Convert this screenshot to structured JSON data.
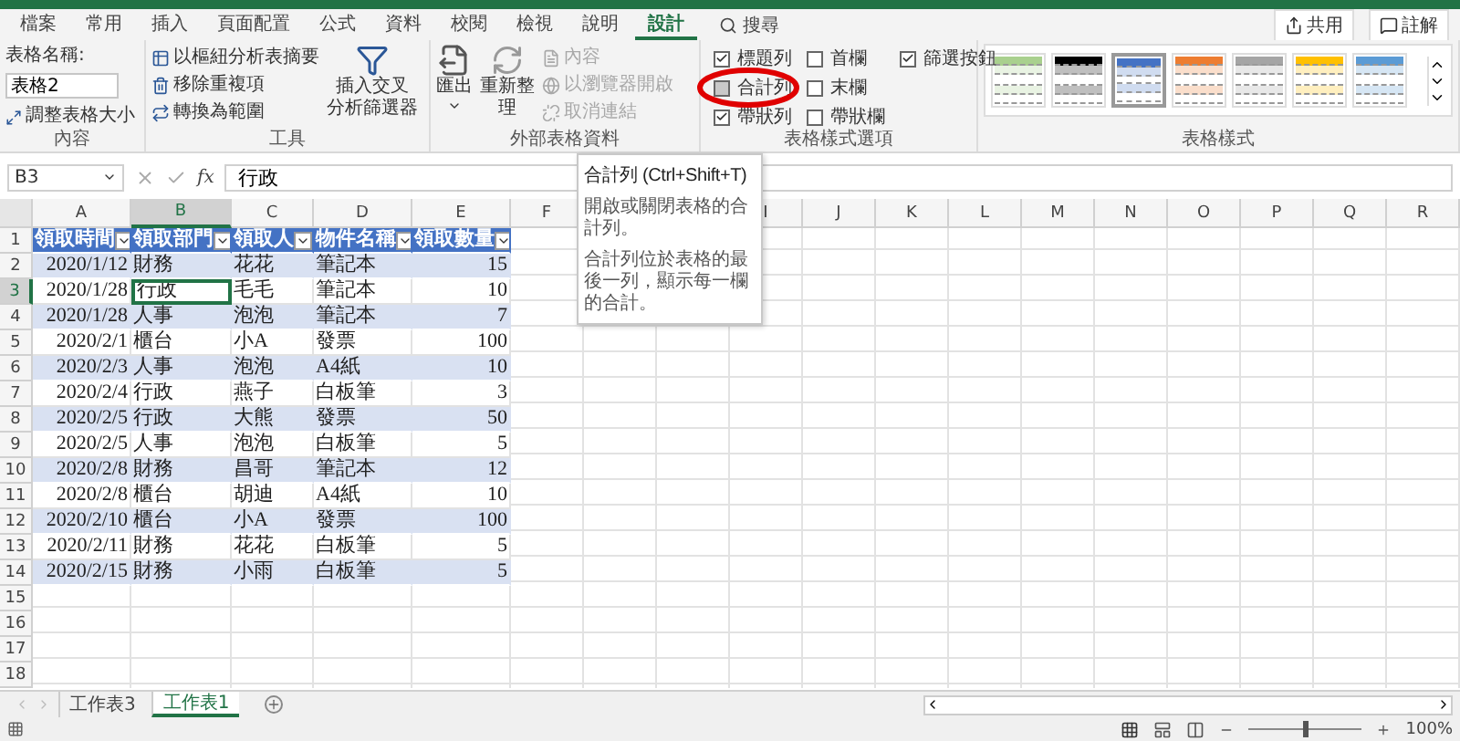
{
  "ribbon_tabs": [
    {
      "label": "檔案",
      "selected": false
    },
    {
      "label": "常用",
      "selected": false
    },
    {
      "label": "插入",
      "selected": false
    },
    {
      "label": "頁面配置",
      "selected": false
    },
    {
      "label": "公式",
      "selected": false
    },
    {
      "label": "資料",
      "selected": false
    },
    {
      "label": "校閱",
      "selected": false
    },
    {
      "label": "檢視",
      "selected": false
    },
    {
      "label": "說明",
      "selected": false
    },
    {
      "label": "設計",
      "selected": true
    }
  ],
  "search": {
    "label": "搜尋"
  },
  "header_buttons": [
    {
      "kind": "share",
      "label": "共用"
    },
    {
      "kind": "comment",
      "label": "註解"
    }
  ],
  "properties": {
    "title": "內容",
    "name_label": "表格名稱:",
    "name_value": "表格2",
    "resize": "調整表格大小"
  },
  "tools": {
    "title": "工具",
    "items": [
      {
        "kind": "pivot",
        "label": "以樞紐分析表摘要"
      },
      {
        "kind": "dedupe",
        "label": "移除重複項"
      },
      {
        "kind": "convert",
        "label": "轉換為範圍"
      }
    ],
    "slicer_lines": [
      "插入交叉",
      "分析篩選器"
    ]
  },
  "external": {
    "title": "外部表格資料",
    "export": "匯出",
    "refresh_lines": [
      "重新整",
      "理"
    ],
    "items": [
      {
        "kind": "properties",
        "label": "內容",
        "disabled": true
      },
      {
        "kind": "browser",
        "label": "以瀏覽器開啟",
        "disabled": true
      },
      {
        "kind": "unlink",
        "label": "取消連結",
        "disabled": true
      }
    ]
  },
  "style_options": {
    "title": "表格樣式選項",
    "options": [
      {
        "kind": "header_row",
        "label": "標題列",
        "checked": true,
        "highlighted": false
      },
      {
        "kind": "total_row",
        "label": "合計列",
        "checked": false,
        "highlighted": true
      },
      {
        "kind": "banded_rows",
        "label": "帶狀列",
        "checked": true,
        "highlighted": false
      },
      {
        "kind": "first_column",
        "label": "首欄",
        "checked": false,
        "highlighted": false
      },
      {
        "kind": "last_column",
        "label": "末欄",
        "checked": false,
        "highlighted": false
      },
      {
        "kind": "banded_columns",
        "label": "帶狀欄",
        "checked": false,
        "highlighted": false
      },
      {
        "kind": "filter_button",
        "label": "篩選按鈕",
        "checked": true,
        "highlighted": false
      }
    ]
  },
  "styles": {
    "title": "表格樣式",
    "items": [
      {
        "color": "#a9d08e",
        "selected": false
      },
      {
        "color": "#000000",
        "selected": false
      },
      {
        "color": "#4472c4",
        "selected": true
      },
      {
        "color": "#ed7d31",
        "selected": false
      },
      {
        "color": "#a5a5a5",
        "selected": false
      },
      {
        "color": "#ffc000",
        "selected": false
      },
      {
        "color": "#5b9bd5",
        "selected": false
      }
    ]
  },
  "formula_bar": {
    "name_box": "B3",
    "function_label": "fx",
    "formula": "行政"
  },
  "sheet": {
    "columns": [
      {
        "kind": "column",
        "label": "A",
        "selected": false
      },
      {
        "kind": "column",
        "label": "B",
        "selected": true
      },
      {
        "kind": "column",
        "label": "C",
        "selected": false
      },
      {
        "kind": "column",
        "label": "D",
        "selected": false
      },
      {
        "kind": "column",
        "label": "E",
        "selected": false
      },
      {
        "kind": "column",
        "label": "F",
        "selected": false
      },
      {
        "kind": "covered"
      },
      {
        "kind": "covered"
      },
      {
        "kind": "column",
        "label": "I",
        "selected": false
      },
      {
        "kind": "column",
        "label": "J",
        "selected": false
      },
      {
        "kind": "column",
        "label": "K",
        "selected": false
      },
      {
        "kind": "column",
        "label": "L",
        "selected": false
      },
      {
        "kind": "column",
        "label": "M",
        "selected": false
      },
      {
        "kind": "column",
        "label": "N",
        "selected": false
      },
      {
        "kind": "column",
        "label": "O",
        "selected": false
      },
      {
        "kind": "column",
        "label": "P",
        "selected": false
      },
      {
        "kind": "column",
        "label": "Q",
        "selected": false
      },
      {
        "kind": "column",
        "label": "R",
        "selected": false
      }
    ],
    "rows": [
      {
        "label": "1",
        "selected": false
      },
      {
        "label": "2",
        "selected": false
      },
      {
        "label": "3",
        "selected": true
      },
      {
        "label": "4",
        "selected": false
      },
      {
        "label": "5",
        "selected": false
      },
      {
        "label": "6",
        "selected": false
      },
      {
        "label": "7",
        "selected": false
      },
      {
        "label": "8",
        "selected": false
      },
      {
        "label": "9",
        "selected": false
      },
      {
        "label": "10",
        "selected": false
      },
      {
        "label": "11",
        "selected": false
      },
      {
        "label": "12",
        "selected": false
      },
      {
        "label": "13",
        "selected": false
      },
      {
        "label": "14",
        "selected": false
      },
      {
        "label": "15",
        "selected": false
      },
      {
        "label": "16",
        "selected": false
      },
      {
        "label": "17",
        "selected": false
      },
      {
        "label": "18",
        "selected": false
      }
    ],
    "table": {
      "headers": [
        "領取時間",
        "領取部門",
        "領取人",
        "物件名稱",
        "領取數量"
      ],
      "rows": [
        [
          "2020/1/12",
          "財務",
          "花花",
          "筆記本",
          "15"
        ],
        [
          "2020/1/28",
          "行政",
          "毛毛",
          "筆記本",
          "10"
        ],
        [
          "2020/1/28",
          "人事",
          "泡泡",
          "筆記本",
          "7"
        ],
        [
          "2020/2/1",
          "櫃台",
          "小A",
          "發票",
          "100"
        ],
        [
          "2020/2/3",
          "人事",
          "泡泡",
          "A4紙",
          "10"
        ],
        [
          "2020/2/4",
          "行政",
          "燕子",
          "白板筆",
          "3"
        ],
        [
          "2020/2/5",
          "行政",
          "大熊",
          "發票",
          "50"
        ],
        [
          "2020/2/5",
          "人事",
          "泡泡",
          "白板筆",
          "5"
        ],
        [
          "2020/2/8",
          "財務",
          "昌哥",
          "筆記本",
          "12"
        ],
        [
          "2020/2/8",
          "櫃台",
          "胡迪",
          "A4紙",
          "10"
        ],
        [
          "2020/2/10",
          "櫃台",
          "小A",
          "發票",
          "100"
        ],
        [
          "2020/2/11",
          "財務",
          "花花",
          "白板筆",
          "5"
        ],
        [
          "2020/2/15",
          "財務",
          "小雨",
          "白板筆",
          "5"
        ]
      ]
    }
  },
  "tooltip": {
    "title": "合計列 (Ctrl+Shift+T)",
    "paragraphs": [
      "開啟或關閉表格的合計列。",
      "合計列位於表格的最後一列，顯示每一欄的合計。"
    ]
  },
  "sheet_tabs": [
    {
      "label": "工作表3",
      "selected": false
    },
    {
      "label": "工作表1",
      "selected": true
    }
  ],
  "status_bar": {
    "zoom": {
      "level": 0.5,
      "reading": "100%"
    }
  }
}
